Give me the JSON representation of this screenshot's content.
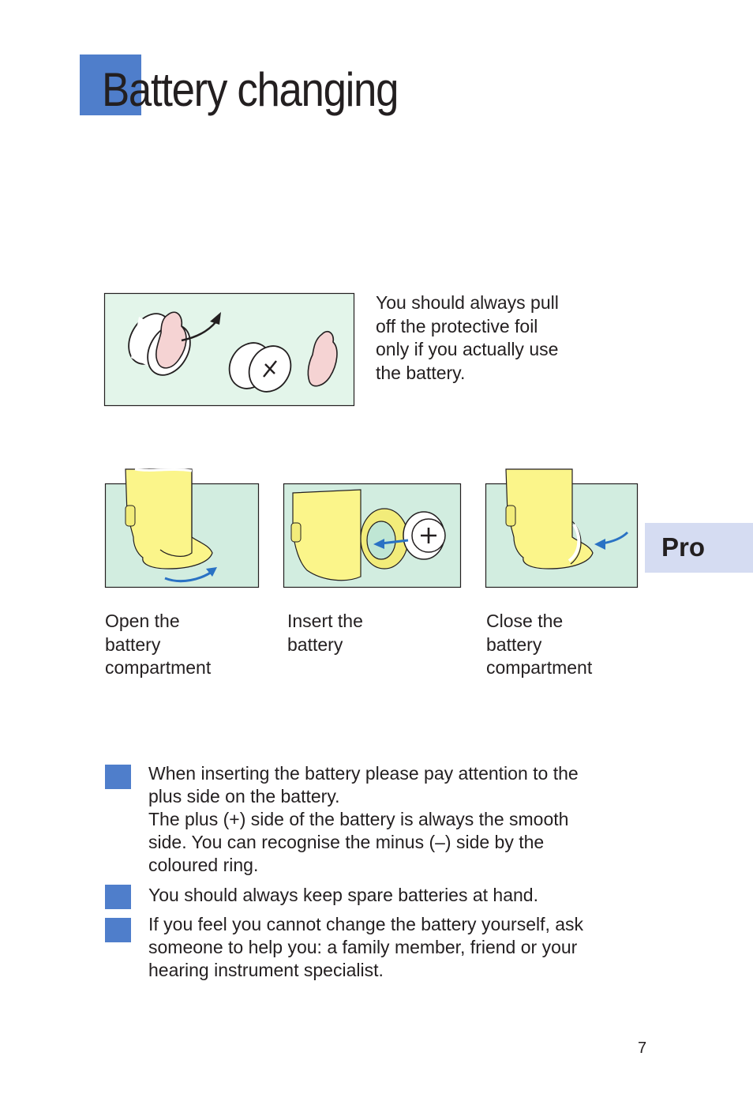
{
  "page": {
    "title": "Battery changing",
    "accent_color": "#4f7ecb",
    "page_number": "7"
  },
  "foil_figure": {
    "icon": "battery-foil-removal-illustration",
    "caption_lines": [
      "You should always pull",
      "off the protective foil",
      "only if you actually use",
      "the battery."
    ]
  },
  "steps": [
    {
      "icon": "open-compartment-illustration",
      "caption_lines": [
        "Open the",
        "battery",
        "compartment"
      ]
    },
    {
      "icon": "insert-battery-illustration",
      "caption_lines": [
        "Insert the",
        "battery"
      ]
    },
    {
      "icon": "close-compartment-illustration",
      "caption_lines": [
        "Close the",
        "battery",
        "compartment"
      ]
    }
  ],
  "side_tab": {
    "label": "Pro",
    "color": "#d5dcf2"
  },
  "bullets": [
    {
      "lines": [
        "When inserting the battery please pay attention to the",
        "plus side on the battery.",
        "The plus (+) side of the battery is always the smooth",
        "side. You can recognise the minus (–) side by the",
        "coloured ring."
      ]
    },
    {
      "lines": [
        "You should always keep spare batteries at hand."
      ]
    },
    {
      "lines": [
        "If you feel you cannot change the battery yourself, ask",
        "someone to help you: a family member, friend or your",
        "hearing instrument specialist."
      ]
    }
  ]
}
